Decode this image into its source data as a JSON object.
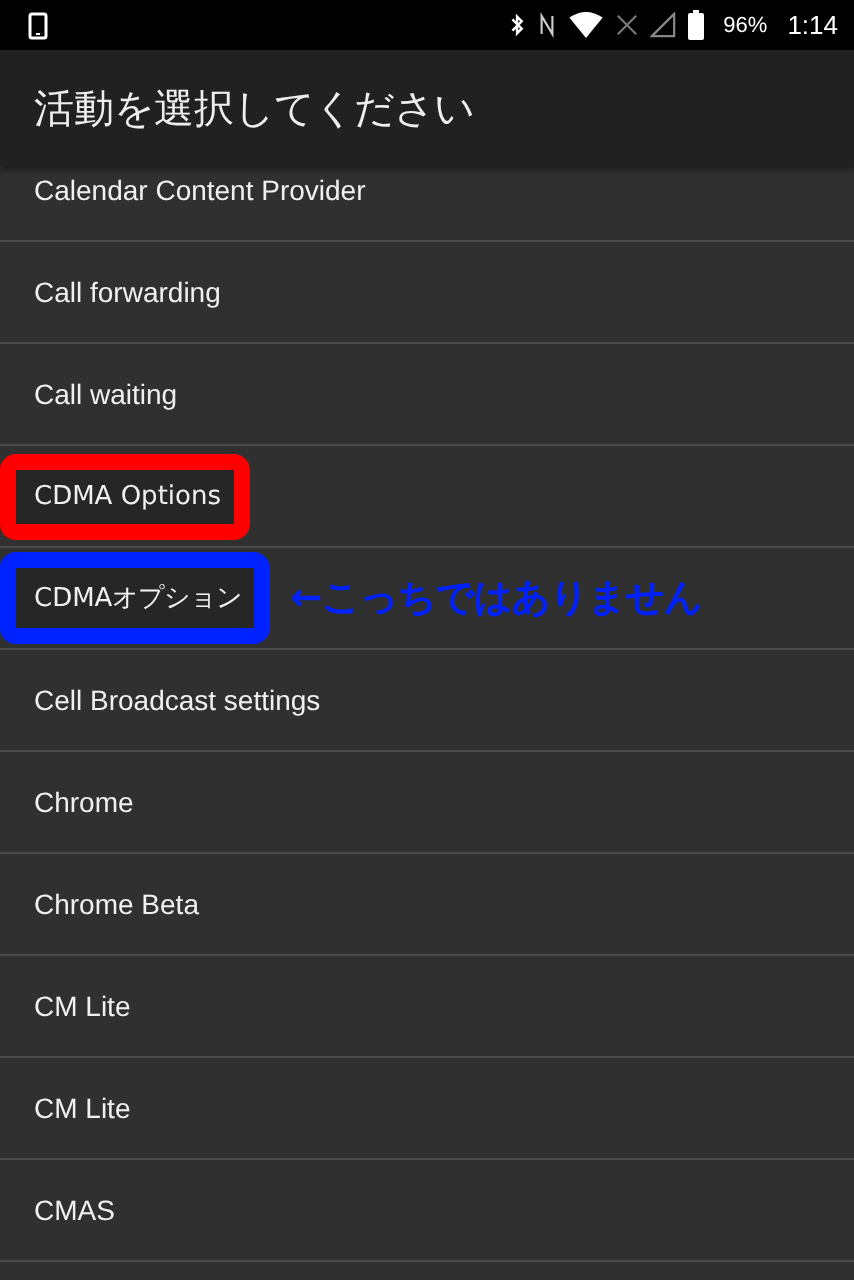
{
  "status_bar": {
    "battery": "96%",
    "time": "1:14"
  },
  "title": "活動を選択してください",
  "items": [
    {
      "label": "Calendar Content Provider"
    },
    {
      "label": "Call forwarding"
    },
    {
      "label": "Call waiting"
    },
    {
      "label": "CDMA Options",
      "color": "#ff0000"
    },
    {
      "label": "CDMAオプション",
      "color": "#0022ff",
      "note": "←こっちではありません"
    },
    {
      "label": "Cell Broadcast settings"
    },
    {
      "label": "Chrome"
    },
    {
      "label": "Chrome Beta"
    },
    {
      "label": "CM Lite"
    },
    {
      "label": "CM Lite"
    },
    {
      "label": "CMAS"
    }
  ]
}
